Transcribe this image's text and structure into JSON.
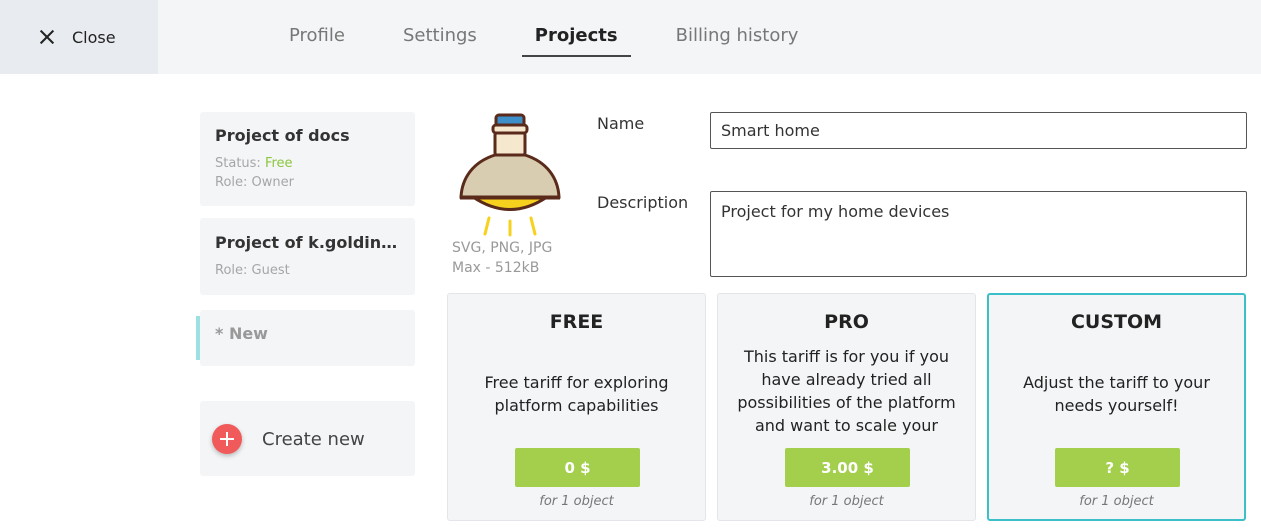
{
  "header": {
    "close_label": "Close",
    "tabs": [
      {
        "label": "Profile"
      },
      {
        "label": "Settings"
      },
      {
        "label": "Projects"
      },
      {
        "label": "Billing history"
      }
    ],
    "active_tab": "Projects"
  },
  "projects": [
    {
      "name": "Project of docs",
      "status_label": "Status:",
      "status_value": "Free",
      "role": "Role: Owner"
    },
    {
      "name": "Project of k.goldinova@opp-plus.com",
      "role": "Role: Guest"
    },
    {
      "name": "* New"
    }
  ],
  "create_new_label": "Create new",
  "image": {
    "icon": "lamp-icon",
    "formats": "SVG, PNG, JPG",
    "max_size": "Max - 512kB"
  },
  "form": {
    "name_label": "Name",
    "name_value": "Smart home",
    "description_label": "Description",
    "description_value": "Project for my home devices"
  },
  "tariffs": [
    {
      "name": "FREE",
      "description": "Free tariff for exploring platform capabilities",
      "price": "0 $",
      "per": "for 1 object"
    },
    {
      "name": "PRO",
      "description": "This tariff is for you if you have already tried all possibilities of the platform and want to scale your",
      "price": "3.00 $",
      "per": "for 1 object"
    },
    {
      "name": "CUSTOM",
      "description": "Adjust the tariff to your needs yourself!",
      "price": "? $",
      "per": "for 1 object"
    }
  ],
  "colors": {
    "accent_green": "#a3cf4d",
    "status_free": "#8cc63f",
    "selected_border": "#3cbfc9",
    "create_button": "#f05a5a",
    "new_indicator": "#9ce0e4"
  }
}
